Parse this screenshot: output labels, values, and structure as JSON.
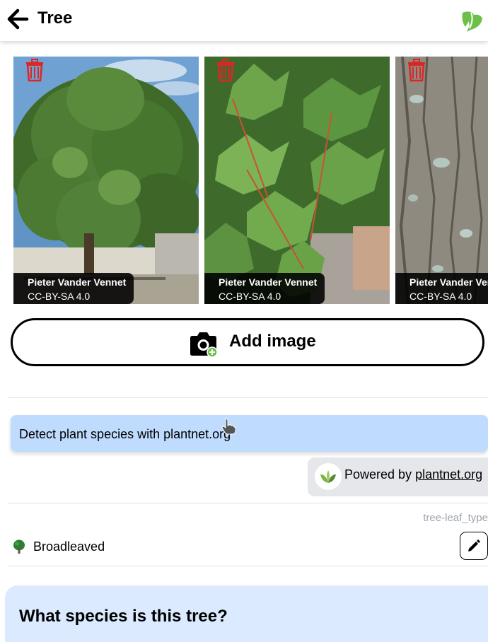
{
  "header": {
    "title": "Tree",
    "back_icon": "arrow-left-icon",
    "logo_icon": "mapcomplete-logo-icon"
  },
  "gallery": {
    "images": [
      {
        "author": "Pieter Vander Vennet",
        "license": "CC-BY-SA 4.0",
        "subject": "tree-crown"
      },
      {
        "author": "Pieter Vander Vennet",
        "license": "CC-BY-SA 4.0",
        "subject": "leaves"
      },
      {
        "author": "Pieter Vander Vennet",
        "license": "CC-BY-SA 4.0",
        "subject": "bark"
      }
    ],
    "delete_icon": "trash-icon",
    "delete_color": "#dc2626"
  },
  "add_image": {
    "label": "Add image",
    "icon": "camera-add-icon"
  },
  "plantnet": {
    "detect_label": "Detect plant species with plantnet.org",
    "powered_prefix": "Powered by",
    "powered_link": "plantnet.org",
    "button_color": "#bfdbfe"
  },
  "leaf_type": {
    "question_id": "tree-leaf_type",
    "answer": "Broadleaved",
    "answer_icon": "broadleaved-tree-icon",
    "edit_icon": "pencil-icon"
  },
  "species_question": {
    "title": "What species is this tree?"
  },
  "colors": {
    "accent_green": "#6cc04a",
    "card_blue": "#dbeafe"
  }
}
